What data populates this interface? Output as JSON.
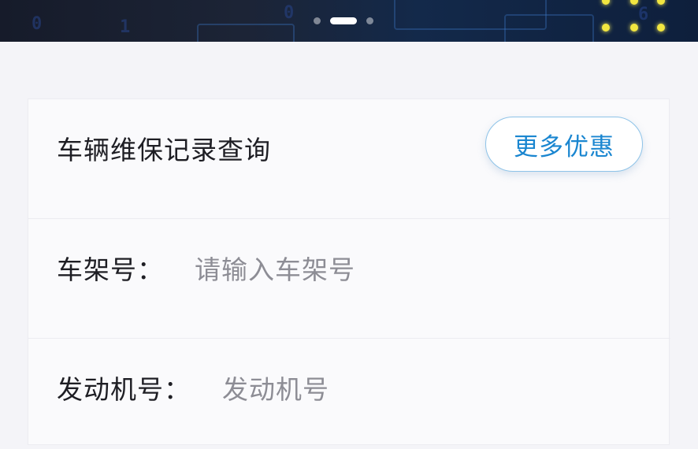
{
  "banner": {
    "carousel_total": 3,
    "carousel_active_index": 2,
    "digits": [
      "0",
      "1",
      "0",
      "6"
    ]
  },
  "query_card": {
    "title": "车辆维保记录查询",
    "more_button_label": "更多优惠",
    "fields": [
      {
        "label": "车架号：",
        "placeholder": "请输入车架号",
        "value": ""
      },
      {
        "label": "发动机号：",
        "placeholder": "发动机号",
        "value": ""
      }
    ]
  },
  "colors": {
    "accent": "#1a86d0",
    "button_border": "#8ec3e8",
    "text_primary": "#1e1e24",
    "text_placeholder": "#8d8d95",
    "page_background": "#f4f4f8"
  }
}
